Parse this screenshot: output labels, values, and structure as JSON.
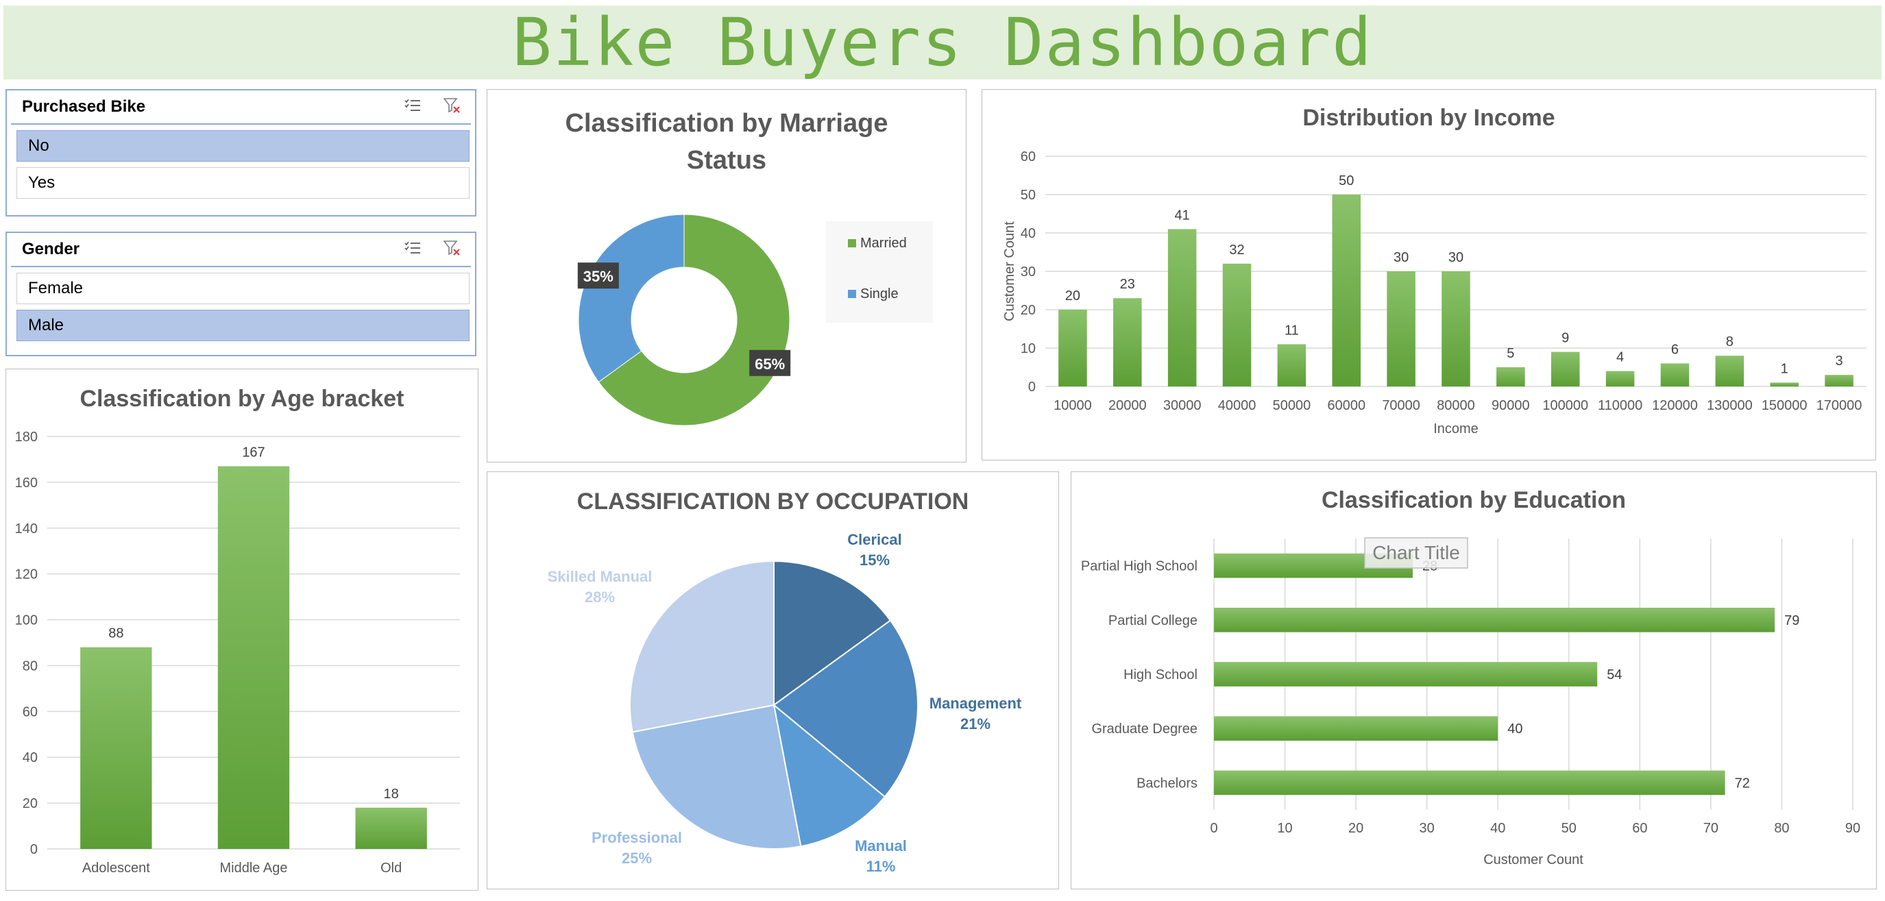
{
  "dashboard": {
    "title": "Bike Buyers Dashboard"
  },
  "slicers": {
    "purchased": {
      "title": "Purchased Bike",
      "items": [
        {
          "label": "No",
          "selected": true
        },
        {
          "label": "Yes",
          "selected": false
        }
      ]
    },
    "gender": {
      "title": "Gender",
      "items": [
        {
          "label": "Female",
          "selected": false
        },
        {
          "label": "Male",
          "selected": true
        }
      ]
    }
  },
  "icons": {
    "multi_select": "multi-select-icon",
    "clear_filter": "clear-filter-icon"
  },
  "colors": {
    "banner_bg": "#e2efda",
    "title_green": "#70ad47",
    "bar_green": "#70ad47",
    "single_blue": "#5b9bd5",
    "selected_item": "#b4c6e7",
    "slicer_border": "#8ea9db"
  },
  "chart_data": [
    {
      "id": "marriage",
      "type": "pie",
      "title": "Classification by Marriage Status",
      "title_lines": [
        "Classification by Marriage",
        "Status"
      ],
      "donut": true,
      "categories": [
        "Married",
        "Single"
      ],
      "values": [
        65,
        35
      ],
      "labels": [
        "65%",
        "35%"
      ],
      "colors": [
        "#70ad47",
        "#5b9bd5"
      ],
      "legend": "right"
    },
    {
      "id": "income",
      "type": "bar",
      "title": "Distribution by Income",
      "xlabel": "Income",
      "ylabel": "Customer Count",
      "categories": [
        "10000",
        "20000",
        "30000",
        "40000",
        "50000",
        "60000",
        "70000",
        "80000",
        "90000",
        "100000",
        "110000",
        "120000",
        "130000",
        "150000",
        "170000"
      ],
      "values": [
        20,
        23,
        41,
        32,
        11,
        50,
        30,
        30,
        5,
        9,
        4,
        6,
        8,
        1,
        3
      ],
      "ylim": [
        0,
        60
      ],
      "yticks": [
        "0",
        "10",
        "20",
        "30",
        "40",
        "50",
        "60"
      ],
      "grid": true
    },
    {
      "id": "age",
      "type": "bar",
      "title": "Classification by Age bracket",
      "categories": [
        "Adolescent",
        "Middle Age",
        "Old"
      ],
      "values": [
        88,
        167,
        18
      ],
      "ylim": [
        0,
        180
      ],
      "yticks": [
        "0",
        "20",
        "40",
        "60",
        "80",
        "100",
        "120",
        "140",
        "160",
        "180"
      ],
      "grid": true
    },
    {
      "id": "occupation",
      "type": "pie",
      "title": "CLASSIFICATION BY OCCUPATION",
      "categories": [
        "Clerical",
        "Management",
        "Manual",
        "Professional",
        "Skilled Manual"
      ],
      "values": [
        15,
        21,
        11,
        25,
        28
      ],
      "labels": [
        "15%",
        "21%",
        "11%",
        "25%",
        "28%"
      ],
      "colors": [
        "#41719c",
        "#4e88c0",
        "#5b9bd5",
        "#9cbde6",
        "#bed0eb"
      ]
    },
    {
      "id": "education",
      "type": "bar",
      "orientation": "horizontal",
      "title": "Classification by Education",
      "overlay_label": "Chart Title",
      "xlabel": "Customer Count",
      "categories": [
        "Partial High School",
        "Partial College",
        "High School",
        "Graduate Degree",
        "Bachelors"
      ],
      "values": [
        28,
        79,
        54,
        40,
        72
      ],
      "xlim": [
        0,
        90
      ],
      "xticks": [
        "0",
        "10",
        "20",
        "30",
        "40",
        "50",
        "60",
        "70",
        "80",
        "90"
      ],
      "grid": true
    }
  ]
}
